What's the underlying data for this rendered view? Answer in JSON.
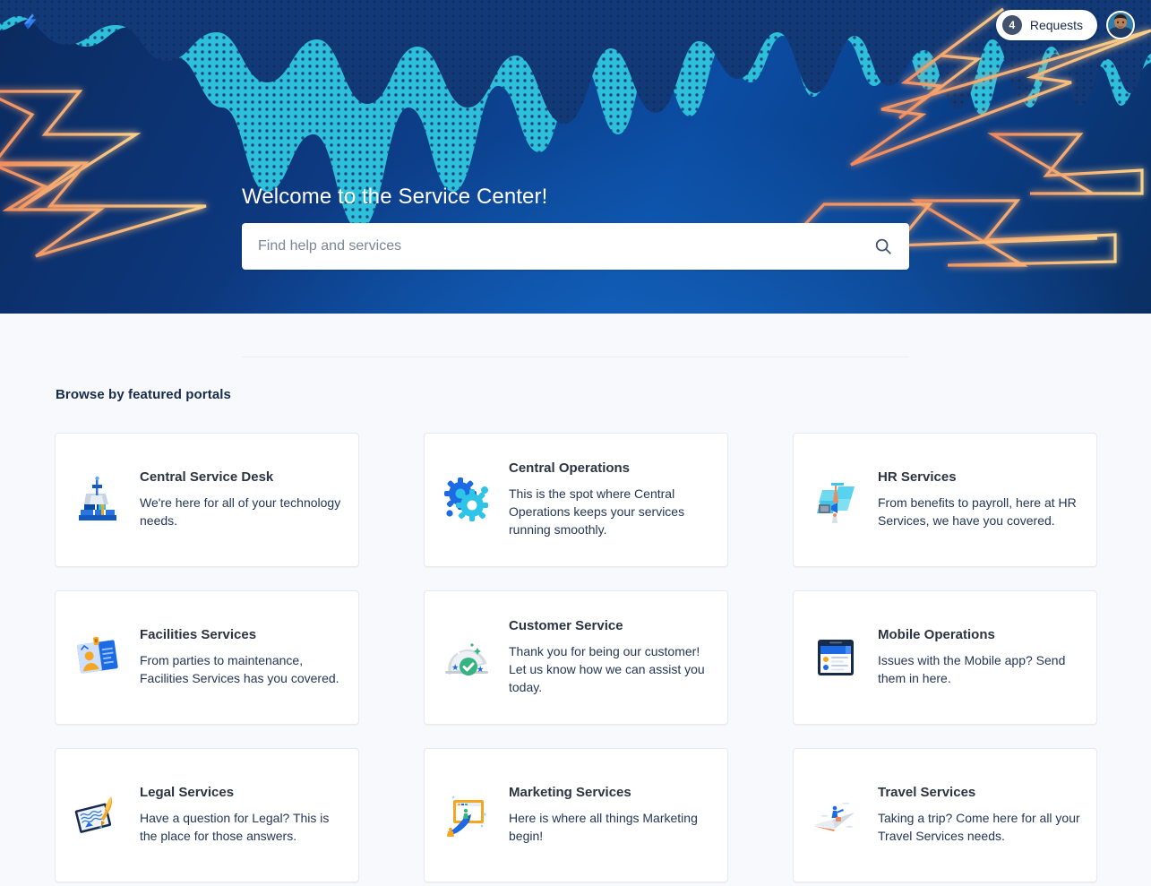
{
  "nav": {
    "logo_icon": "jira-lightning-logo-icon",
    "requests_count": "4",
    "requests_label": "Requests",
    "avatar_icon": "user-avatar"
  },
  "hero": {
    "title": "Welcome to the Service Center!",
    "search_placeholder": "Find help and services",
    "search_value": "",
    "search_icon": "search-icon",
    "colors": {
      "deep_blue": "#0b2a5e",
      "mid_blue": "#0b4da3",
      "cyan": "#2ac4e0",
      "bolt_orange": "#f6a06a"
    }
  },
  "main": {
    "section_title": "Browse by featured portals",
    "portals": [
      {
        "title": "Central Service Desk",
        "description": "We're here for all of your technology needs.",
        "icon": "service-desk-icon"
      },
      {
        "title": "Central Operations",
        "description": "This is the spot where Central Operations keeps your services running smoothly.",
        "icon": "gears-icon"
      },
      {
        "title": "HR Services",
        "description": "From benefits to payroll, here at HR Services, we have you covered.",
        "icon": "hr-people-icon"
      },
      {
        "title": "Facilities Services",
        "description": "From parties to maintenance, Facilities Services has you covered.",
        "icon": "facilities-badge-icon"
      },
      {
        "title": "Customer Service",
        "description": "Thank you for being our customer! Let us know how we can assist you today.",
        "icon": "service-cloche-check-icon"
      },
      {
        "title": "Mobile Operations",
        "description": "Issues with the Mobile app? Send them in here.",
        "icon": "mobile-device-icon"
      },
      {
        "title": "Legal Services",
        "description": "Have a question for Legal? This is the place for those answers.",
        "icon": "legal-tablet-pen-icon"
      },
      {
        "title": "Marketing Services",
        "description": "Here is where all things Marketing begin!",
        "icon": "marketing-board-icon"
      },
      {
        "title": "Travel Services",
        "description": "Taking a trip? Come here for all your Travel Services needs.",
        "icon": "travel-paper-plane-icon"
      }
    ]
  }
}
